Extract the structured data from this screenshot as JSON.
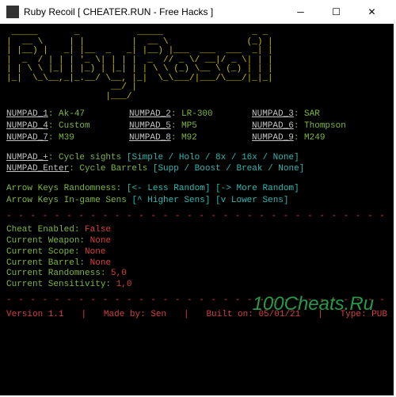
{
  "window": {
    "title": "Ruby Recoil [ CHEATER.RUN - Free Hacks ]"
  },
  "ascii_art": " _____       _           _____                 _ _\n|  __ \\     | |         |  __ \\               (_) |\n| |__) |   _| |__  _   _| |__) |___  ___  ___  _| |\n|  _  / | | | '_ \\| | | |  _  // _ \\/ __|/ _ \\| | |\n| | \\ \\ |_| | |_) | |_| | | \\ \\ (_) \\__ \\ (_) | | |\n|_|  \\_\\__,_|_.__/ \\__, |_|  \\_\\___/|___/\\___/|_|_|\n                    __/ |\n                   |___/",
  "binds": [
    {
      "key": "NUMPAD_1",
      "val": "Ak-47"
    },
    {
      "key": "NUMPAD_2",
      "val": "LR-300"
    },
    {
      "key": "NUMPAD_3",
      "val": "SAR"
    },
    {
      "key": "NUMPAD_4",
      "val": "Custom"
    },
    {
      "key": "NUMPAD_5",
      "val": "MP5"
    },
    {
      "key": "NUMPAD_6",
      "val": "Thompson"
    },
    {
      "key": "NUMPAD_7",
      "val": "M39"
    },
    {
      "key": "NUMPAD_8",
      "val": "M92"
    },
    {
      "key": "NUMPAD_9",
      "val": "M249"
    }
  ],
  "cycle_sights": {
    "key": "NUMPAD_+",
    "prefix": "Cycle sights",
    "opts": "[Simple / Holo / 8x / 16x / None]"
  },
  "cycle_barrels": {
    "key": "NUMPAD_Enter",
    "prefix": "Cycle Barrels",
    "opts": "[Supp / Boost / Break / None]"
  },
  "arrow_random": {
    "label": "Arrow Keys Randomness:",
    "left": "[<- Less Random]",
    "right": "[-> More Random]"
  },
  "arrow_sens": {
    "label": "Arrow Keys In-game Sens",
    "up": "[^ Higher Sens]",
    "down": "[v Lower Sens]"
  },
  "status": {
    "cheat_enabled": {
      "label": "Cheat Enabled:",
      "val": "False"
    },
    "weapon": {
      "label": "Current Weapon:",
      "val": "None"
    },
    "scope": {
      "label": "Current Scope:",
      "val": "None"
    },
    "barrel": {
      "label": "Current Barrel:",
      "val": "None"
    },
    "randomness": {
      "label": "Current Randomness:",
      "val": "5,0"
    },
    "sensitivity": {
      "label": "Current Sensitivity:",
      "val": "1,0"
    }
  },
  "divider": "- - - - - - - - - - - - - - - - - - - - - - - - - - - - - - - - - - - -",
  "footer": {
    "version": "Version 1.1",
    "sep": "|",
    "made_by": "Made by: Sen",
    "built_on": "Built on: 05/01/21",
    "type": "Type: PUB"
  },
  "watermark": "100Cheats.Ru"
}
